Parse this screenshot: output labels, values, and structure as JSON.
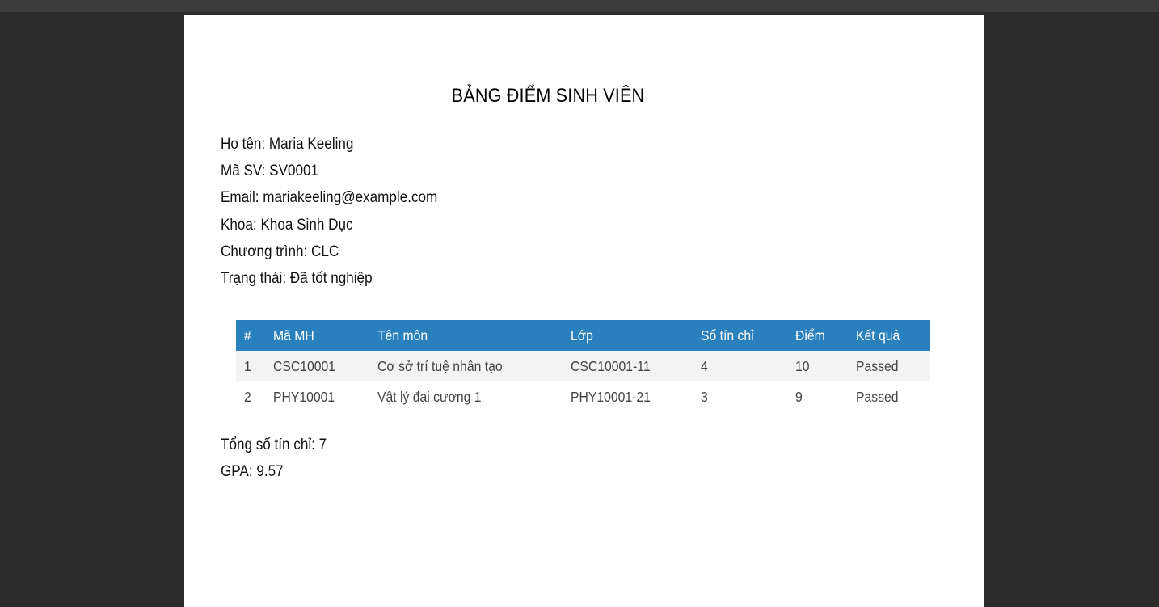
{
  "document": {
    "title": "BẢNG ĐIỂM SINH VIÊN"
  },
  "student": {
    "name_line": "Họ tên: Maria Keeling",
    "id_line": "Mã SV: SV0001",
    "email_line": "Email: mariakeeling@example.com",
    "faculty_line": "Khoa: Khoa Sinh Dục",
    "program_line": "Chương trình: CLC",
    "status_line": "Trạng thái: Đã tốt nghiệp"
  },
  "table": {
    "headers": [
      "#",
      "Mã MH",
      "Tên môn",
      "Lớp",
      "Số tín chỉ",
      "Điểm",
      "Kết quả"
    ],
    "rows": [
      [
        "1",
        "CSC10001",
        "Cơ sở trí tuệ nhân tạo",
        "CSC10001-11",
        "4",
        "10",
        "Passed"
      ],
      [
        "2",
        "PHY10001",
        "Vật lý đại cương 1",
        "PHY10001-21",
        "3",
        "9",
        "Passed"
      ]
    ]
  },
  "summary": {
    "credits_line": "Tổng số tín chỉ: 7",
    "gpa_line": "GPA: 9.57"
  },
  "colors": {
    "header_bg": "#2a80bd",
    "viewer_bg": "#2b2b2b",
    "row_alt_bg": "#f3f3f3"
  }
}
